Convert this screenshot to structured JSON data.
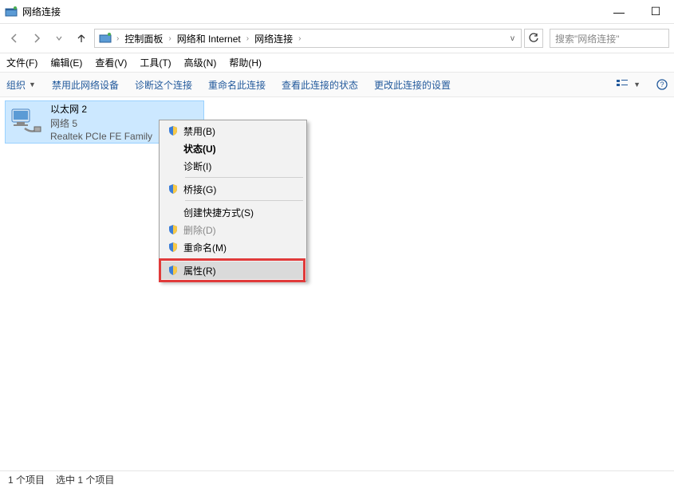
{
  "window": {
    "title": "网络连接"
  },
  "titlebar_controls": {
    "minimize": "—",
    "maximize": "☐"
  },
  "breadcrumb": {
    "items": [
      "控制面板",
      "网络和 Internet",
      "网络连接"
    ]
  },
  "search": {
    "placeholder": "搜索\"网络连接\""
  },
  "menubar": [
    "文件(F)",
    "编辑(E)",
    "查看(V)",
    "工具(T)",
    "高级(N)",
    "帮助(H)"
  ],
  "toolbar": {
    "organize": "组织",
    "items": [
      "禁用此网络设备",
      "诊断这个连接",
      "重命名此连接",
      "查看此连接的状态",
      "更改此连接的设置"
    ]
  },
  "connection": {
    "name": "以太网 2",
    "status": "网络 5",
    "device": "Realtek PCIe FE Family"
  },
  "context_menu": {
    "groups": [
      {
        "items": [
          {
            "label": "禁用(B)",
            "shield": true,
            "enabled": true
          },
          {
            "label": "状态(U)",
            "shield": false,
            "enabled": true,
            "bold": true
          },
          {
            "label": "诊断(I)",
            "shield": false,
            "enabled": true
          }
        ]
      },
      {
        "items": [
          {
            "label": "桥接(G)",
            "shield": true,
            "enabled": true
          }
        ]
      },
      {
        "items": [
          {
            "label": "创建快捷方式(S)",
            "shield": false,
            "enabled": true
          },
          {
            "label": "删除(D)",
            "shield": true,
            "enabled": false
          },
          {
            "label": "重命名(M)",
            "shield": true,
            "enabled": true
          }
        ]
      },
      {
        "items": [
          {
            "label": "属性(R)",
            "shield": true,
            "enabled": true,
            "hover": true
          }
        ]
      }
    ]
  },
  "statusbar": {
    "left": "1 个项目",
    "right": "选中 1 个项目"
  }
}
